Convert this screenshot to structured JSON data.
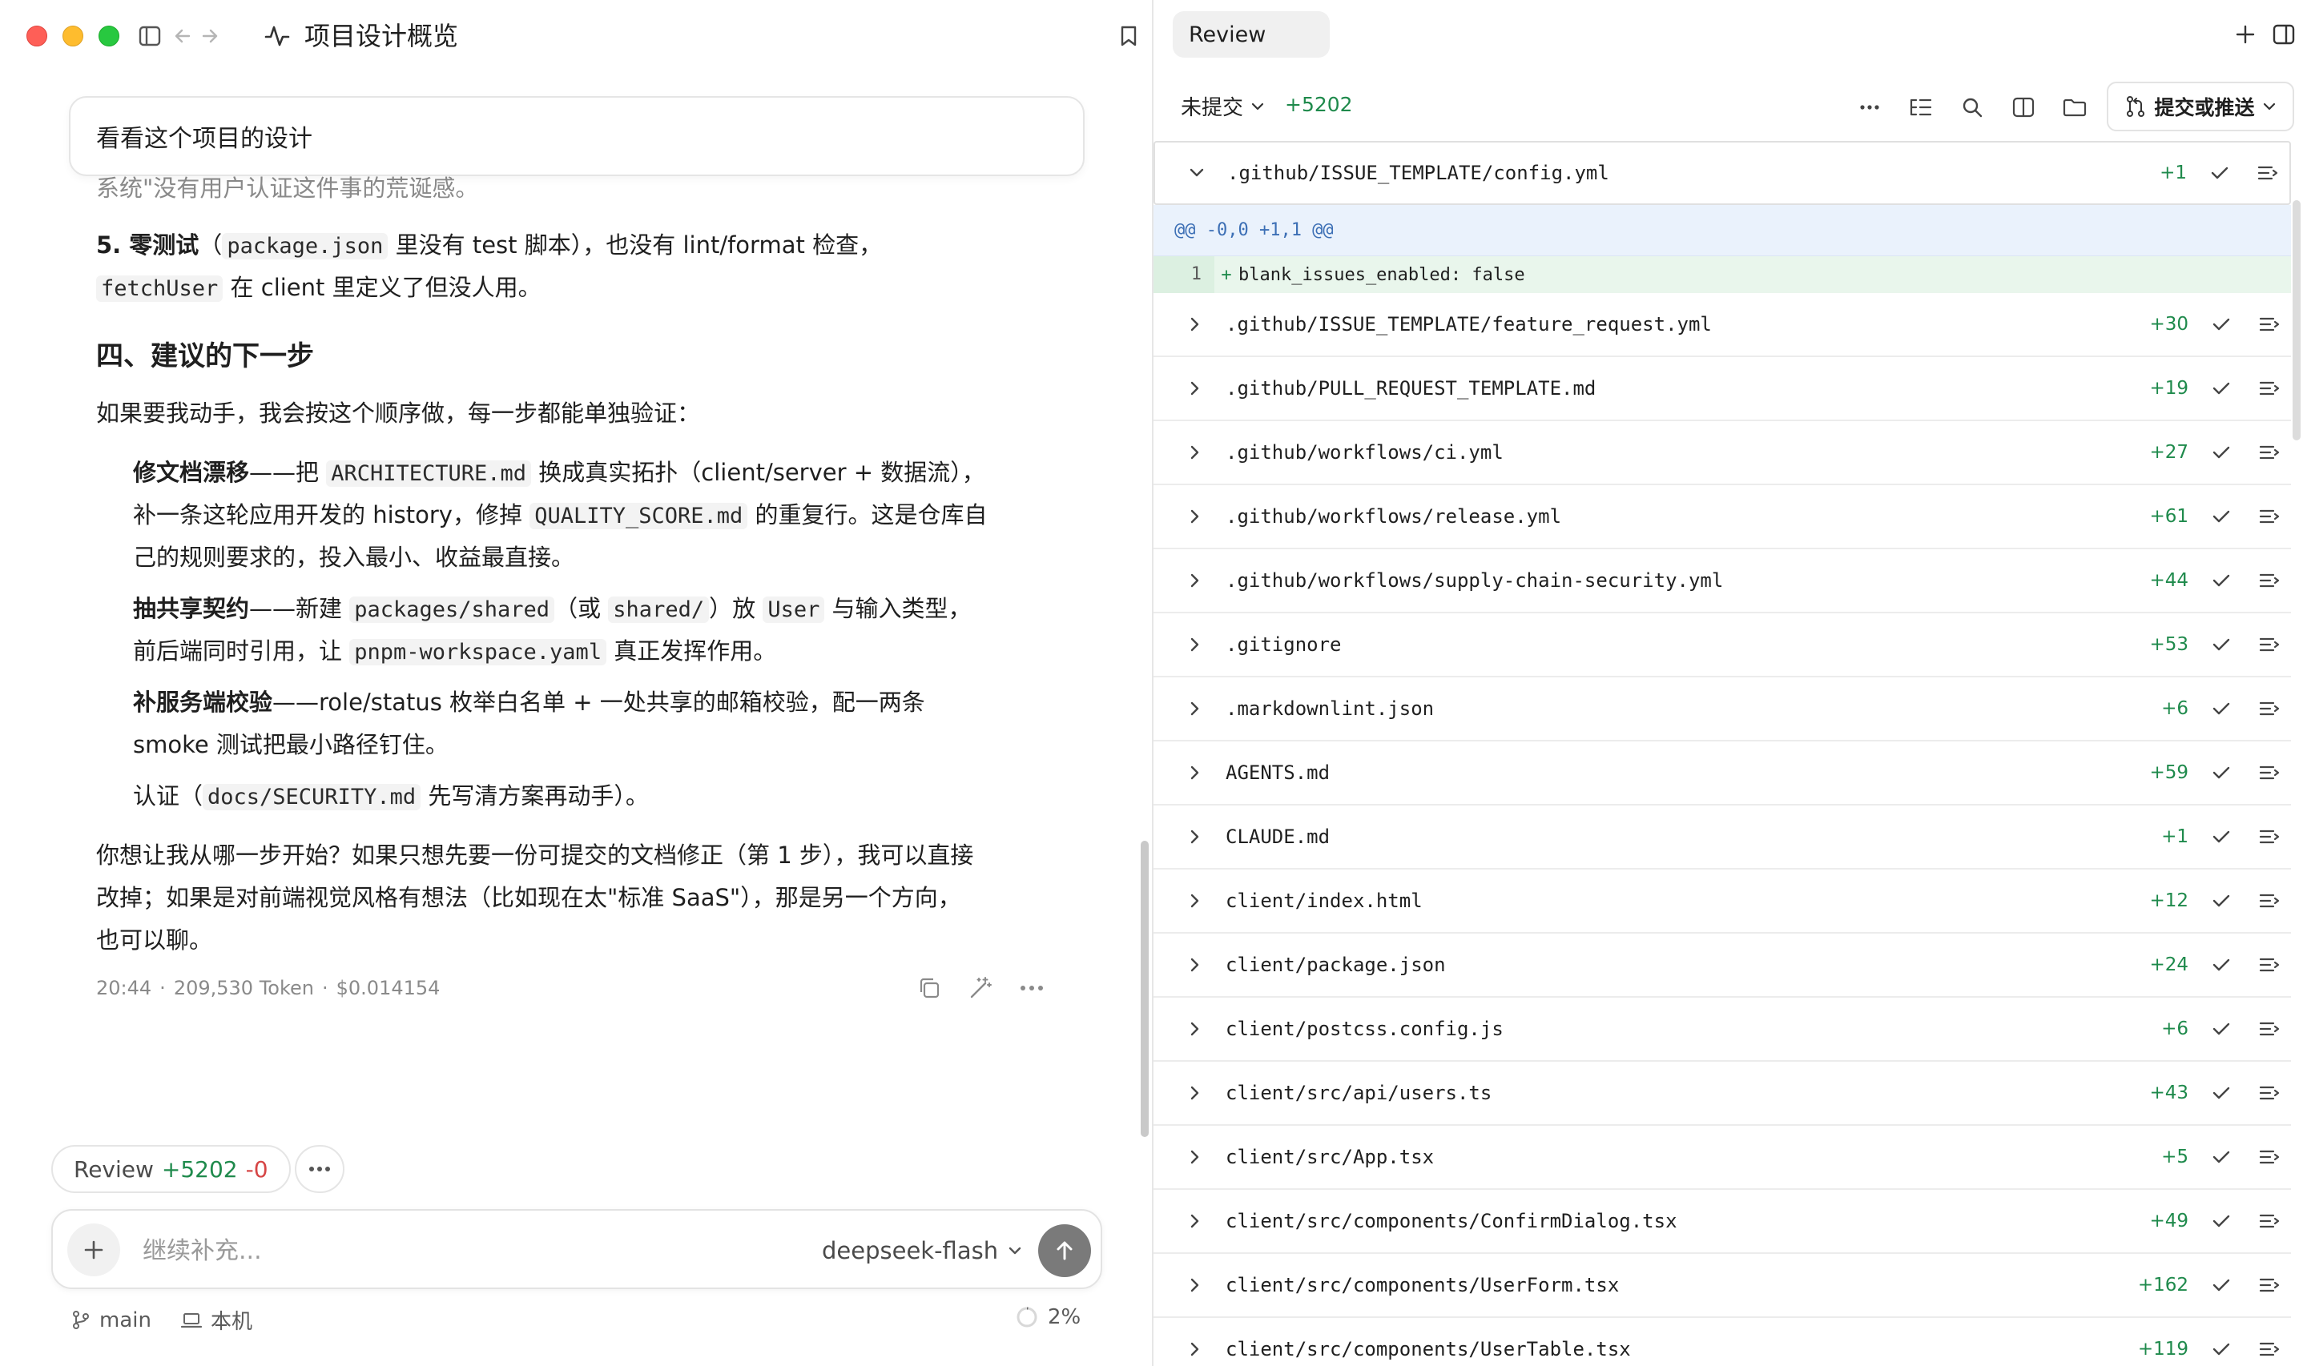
{
  "window": {
    "title": "项目设计概览"
  },
  "chat": {
    "question": "看看这个项目的设计",
    "faded_line": "系统\"没有用户认证这件事的荒诞感。",
    "item5": {
      "label": "5. 零测试",
      "t1": "（",
      "code1": "package.json",
      "t2": " 里没有 test 脚本），也没有 lint/format 检查，",
      "code2": "fetchUser",
      "t3": " 在 client 里定义了但没人用。"
    },
    "section4_title": "四、建议的下一步",
    "intro": "如果要我动手，我会按这个顺序做，每一步都能单独验证：",
    "step1": {
      "label": "修文档漂移",
      "t1": "——把 ",
      "code1": "ARCHITECTURE.md",
      "t2": " 换成真实拓扑（client/server + 数据流），",
      "line2a": "补一条这轮应用开发的 history，修掉 ",
      "code2": "QUALITY_SCORE.md",
      "line2b": " 的重复行。这是仓库自",
      "line3": "己的规则要求的，投入最小、收益最直接。"
    },
    "step2": {
      "label": "抽共享契约",
      "t1": "——新建 ",
      "code1": "packages/shared",
      "t2": "（或 ",
      "code2": "shared/",
      "t3": "）放 ",
      "code3": "User",
      "t4": " 与输入类型，",
      "line2a": "前后端同时引用，让 ",
      "code4": "pnpm-workspace.yaml",
      "line2b": " 真正发挥作用。"
    },
    "step3": {
      "label": "补服务端校验",
      "t1": "——role/status 枚举白名单 + 一处共享的邮箱校验，配一两条",
      "line2": "smoke 测试把最小路径钉住。"
    },
    "step4": {
      "t1": "认证（",
      "code1": "docs/SECURITY.md",
      "t2": " 先写清方案再动手）。"
    },
    "closing": {
      "line1": "你想让我从哪一步开始？如果只想先要一份可提交的文档修正（第 1 步），我可以直接",
      "line2": "改掉；如果是对前端视觉风格有想法（比如现在太\"标准 SaaS\"），那是另一个方向，",
      "line3": "也可以聊。"
    },
    "meta": {
      "time": "20:44",
      "sep": "·",
      "tokens": "209,530 Token",
      "cost": "$0.014154"
    }
  },
  "review_chip": {
    "label": "Review",
    "added": "+5202",
    "removed": "-0"
  },
  "composer": {
    "placeholder": "继续补充...",
    "model": "deepseek-flash"
  },
  "footer": {
    "branch": "main",
    "location": "本机",
    "context_percent": "2%"
  },
  "review_panel": {
    "tab_label": "Review",
    "scope": "未提交",
    "total_added": "+5202",
    "commit_push_label": "提交或推送",
    "expanded_file": {
      "name": ".github/ISSUE_TEMPLATE/config.yml",
      "count": "+1",
      "hunk": "@@ -0,0 +1,1 @@",
      "line_no": "1",
      "sign": "+",
      "line": "blank_issues_enabled: false"
    },
    "files": [
      {
        "name": ".github/ISSUE_TEMPLATE/feature_request.yml",
        "count": "+30"
      },
      {
        "name": ".github/PULL_REQUEST_TEMPLATE.md",
        "count": "+19"
      },
      {
        "name": ".github/workflows/ci.yml",
        "count": "+27"
      },
      {
        "name": ".github/workflows/release.yml",
        "count": "+61"
      },
      {
        "name": ".github/workflows/supply-chain-security.yml",
        "count": "+44"
      },
      {
        "name": ".gitignore",
        "count": "+53"
      },
      {
        "name": ".markdownlint.json",
        "count": "+6"
      },
      {
        "name": "AGENTS.md",
        "count": "+59"
      },
      {
        "name": "CLAUDE.md",
        "count": "+1"
      },
      {
        "name": "client/index.html",
        "count": "+12"
      },
      {
        "name": "client/package.json",
        "count": "+24"
      },
      {
        "name": "client/postcss.config.js",
        "count": "+6"
      },
      {
        "name": "client/src/api/users.ts",
        "count": "+43"
      },
      {
        "name": "client/src/App.tsx",
        "count": "+5"
      },
      {
        "name": "client/src/components/ConfirmDialog.tsx",
        "count": "+49"
      },
      {
        "name": "client/src/components/UserForm.tsx",
        "count": "+162"
      },
      {
        "name": "client/src/components/UserTable.tsx",
        "count": "+119"
      }
    ]
  }
}
